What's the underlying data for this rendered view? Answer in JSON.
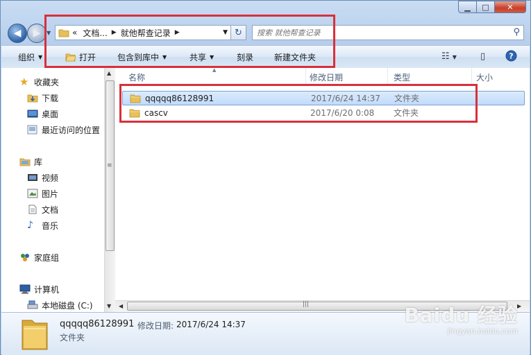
{
  "colors": {
    "annotation": "#d8303a",
    "selection_bg": "#cce2fc",
    "folder": "#e8c05a"
  },
  "address_bar": {
    "segments": [
      "«",
      "文档...",
      "就他帮查记录"
    ],
    "refresh_icon": "refresh-icon"
  },
  "search": {
    "placeholder": "搜索 就他帮查记录"
  },
  "toolbar": {
    "organize": "组织",
    "open": "打开",
    "include_in_library": "包含到库中",
    "share": "共享",
    "burn": "刻录",
    "new_folder": "新建文件夹"
  },
  "nav": {
    "favorites": "收藏夹",
    "downloads": "下载",
    "desktop": "桌面",
    "recent": "最近访问的位置",
    "libraries": "库",
    "videos": "视频",
    "pictures": "图片",
    "documents": "文档",
    "music": "音乐",
    "homegroup": "家庭组",
    "computer": "计算机",
    "local_disk": "本地磁盘 (C:)"
  },
  "columns": {
    "name": "名称",
    "date_modified": "修改日期",
    "type": "类型",
    "size": "大小"
  },
  "files": [
    {
      "name": "qqqqq86128991",
      "date": "2017/6/24 14:37",
      "type": "文件夹",
      "selected": true
    },
    {
      "name": "cascv",
      "date": "2017/6/20 0:08",
      "type": "文件夹",
      "selected": false
    }
  ],
  "details": {
    "name": "qqqqq86128991",
    "date_label": "修改日期:",
    "date_value": "2017/6/24 14:37",
    "type": "文件夹"
  },
  "watermark": {
    "logo": "Baidu 经验",
    "url": "jingyan.baidu.com"
  }
}
